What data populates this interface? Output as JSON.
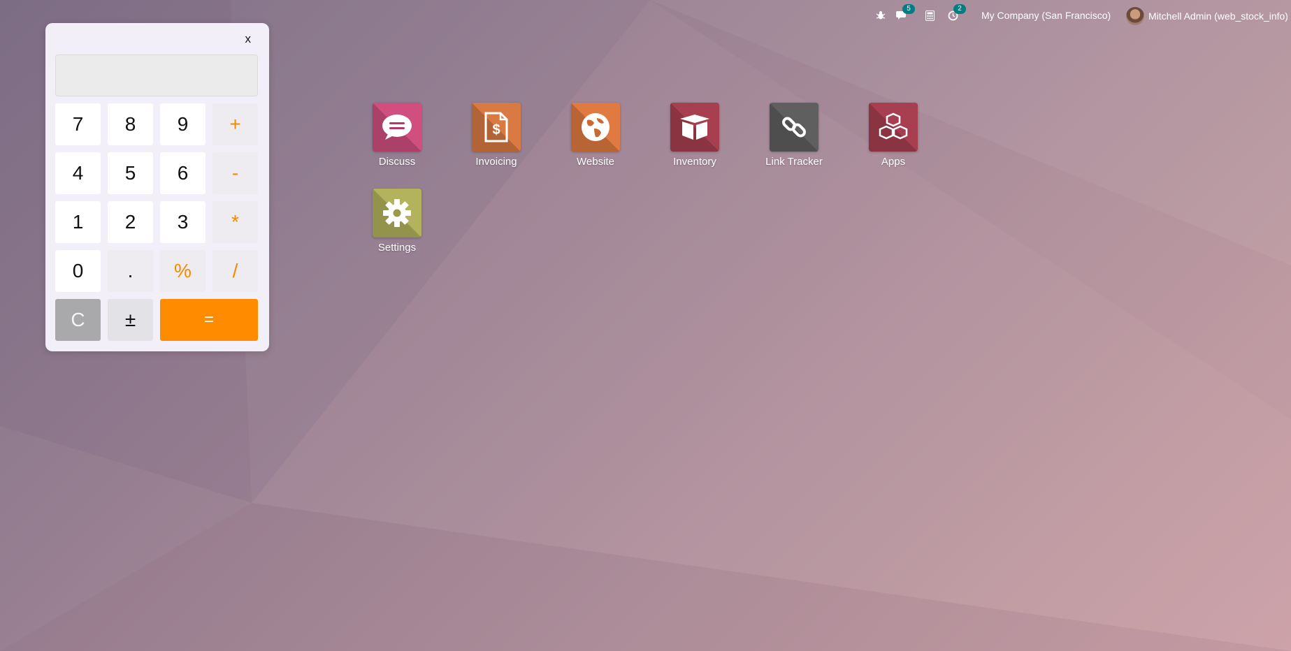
{
  "topbar": {
    "debug_icon": "bug-icon",
    "messages_badge": "5",
    "calculator_icon": "calculator-icon",
    "activities_badge": "2",
    "company": "My Company (San Francisco)",
    "user_name": "Mitchell Admin (web_stock_info)"
  },
  "calculator": {
    "close_label": "x",
    "display_value": "",
    "keys": {
      "k7": "7",
      "k8": "8",
      "k9": "9",
      "plus": "+",
      "k4": "4",
      "k5": "5",
      "k6": "6",
      "minus": "-",
      "k1": "1",
      "k2": "2",
      "k3": "3",
      "multiply": "*",
      "k0": "0",
      "dot": ".",
      "percent": "%",
      "divide": "/",
      "clear": "C",
      "plusminus": "±",
      "equals": "="
    }
  },
  "apps": [
    {
      "label": "Discuss",
      "color": "#d14f7f",
      "icon": "chat-bubble-icon"
    },
    {
      "label": "Invoicing",
      "color": "#d97a42",
      "icon": "invoice-icon"
    },
    {
      "label": "Website",
      "color": "#e07a40",
      "icon": "globe-icon"
    },
    {
      "label": "Inventory",
      "color": "#a83f50",
      "icon": "box-icon"
    },
    {
      "label": "Link Tracker",
      "color": "#5f5f5f",
      "icon": "link-icon"
    },
    {
      "label": "Apps",
      "color": "#a83f50",
      "icon": "cubes-icon"
    },
    {
      "label": "Settings",
      "color": "#b3b35d",
      "icon": "gear-icon"
    }
  ]
}
